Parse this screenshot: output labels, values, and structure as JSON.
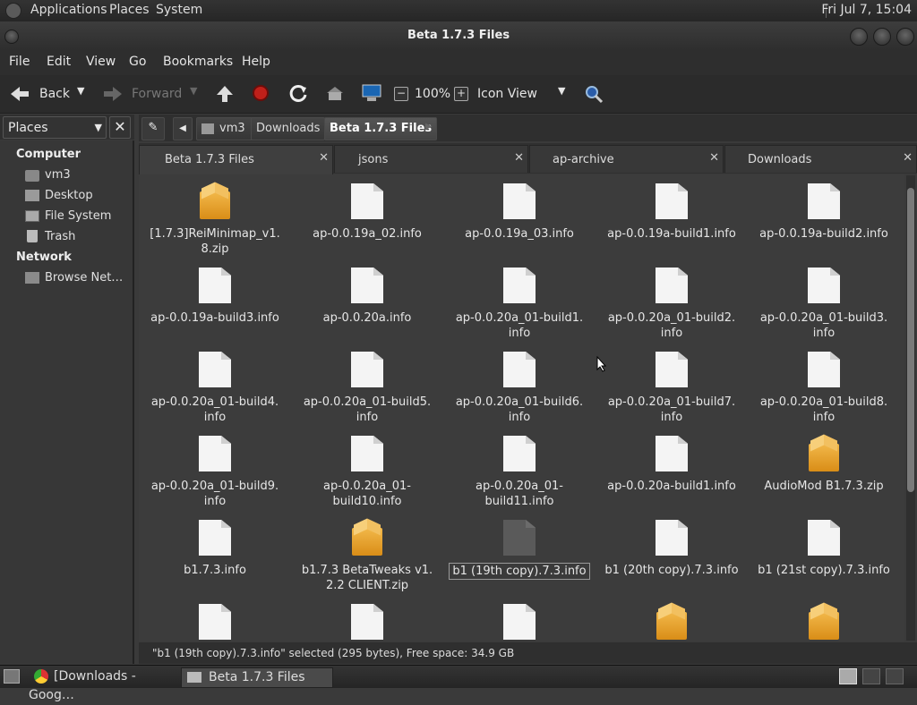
{
  "top_panel": {
    "menus": [
      "Applications",
      "Places",
      "System"
    ],
    "clock": "Fri Jul  7, 15:04"
  },
  "window": {
    "title": "Beta 1.7.3 Files"
  },
  "menubar": [
    "File",
    "Edit",
    "View",
    "Go",
    "Bookmarks",
    "Help"
  ],
  "toolbar": {
    "back": "Back",
    "forward": "Forward",
    "zoom": "100%",
    "view_mode": "Icon View"
  },
  "sidebar": {
    "header": "Places",
    "sections": [
      {
        "title": "Computer",
        "items": [
          "vm3",
          "Desktop",
          "File System",
          "Trash"
        ]
      },
      {
        "title": "Network",
        "items": [
          "Browse Net…"
        ]
      }
    ]
  },
  "path": [
    "vm3",
    "Downloads",
    "Beta 1.7.3 Files"
  ],
  "tabs": [
    "Beta 1.7.3 Files",
    "jsons",
    "ap-archive",
    "Downloads"
  ],
  "files": [
    {
      "name": "[1.7.3]ReiMinimap_v1.\n8.zip",
      "type": "zip"
    },
    {
      "name": "ap-0.0.19a_02.info",
      "type": "doc"
    },
    {
      "name": "ap-0.0.19a_03.info",
      "type": "doc"
    },
    {
      "name": "ap-0.0.19a-build1.info",
      "type": "doc"
    },
    {
      "name": "ap-0.0.19a-build2.info",
      "type": "doc"
    },
    {
      "name": "ap-0.0.19a-build3.info",
      "type": "doc"
    },
    {
      "name": "ap-0.0.20a.info",
      "type": "doc"
    },
    {
      "name": "ap-0.0.20a_01-build1.\ninfo",
      "type": "doc"
    },
    {
      "name": "ap-0.0.20a_01-build2.\ninfo",
      "type": "doc"
    },
    {
      "name": "ap-0.0.20a_01-build3.\ninfo",
      "type": "doc"
    },
    {
      "name": "ap-0.0.20a_01-build4.\ninfo",
      "type": "doc"
    },
    {
      "name": "ap-0.0.20a_01-build5.\ninfo",
      "type": "doc"
    },
    {
      "name": "ap-0.0.20a_01-build6.\ninfo",
      "type": "doc"
    },
    {
      "name": "ap-0.0.20a_01-build7.\ninfo",
      "type": "doc"
    },
    {
      "name": "ap-0.0.20a_01-build8.\ninfo",
      "type": "doc"
    },
    {
      "name": "ap-0.0.20a_01-build9.\ninfo",
      "type": "doc"
    },
    {
      "name": "ap-0.0.20a_01-\nbuild10.info",
      "type": "doc"
    },
    {
      "name": "ap-0.0.20a_01-\nbuild11.info",
      "type": "doc"
    },
    {
      "name": "ap-0.0.20a-build1.info",
      "type": "doc"
    },
    {
      "name": "AudioMod B1.7.3.zip",
      "type": "zip"
    },
    {
      "name": "b1.7.3.info",
      "type": "doc"
    },
    {
      "name": "b1.7.3 BetaTweaks v1.\n2.2 CLIENT.zip",
      "type": "zip"
    },
    {
      "name": "b1 (19th copy).7.3.info",
      "type": "doc",
      "selected": true
    },
    {
      "name": "b1 (20th copy).7.3.info",
      "type": "doc"
    },
    {
      "name": "b1 (21st copy).7.3.info",
      "type": "doc"
    },
    {
      "name": "",
      "type": "doc"
    },
    {
      "name": "",
      "type": "doc"
    },
    {
      "name": "",
      "type": "doc"
    },
    {
      "name": "",
      "type": "zip"
    },
    {
      "name": "",
      "type": "zip"
    }
  ],
  "status": "\"b1 (19th copy).7.3.info\" selected (295 bytes), Free space: 34.9 GB",
  "taskbar": [
    "[Downloads - Goog…",
    "Beta 1.7.3 Files"
  ],
  "colors": {
    "folder_zip": "#e9a42a",
    "window_bg": "#3c3c3c"
  }
}
